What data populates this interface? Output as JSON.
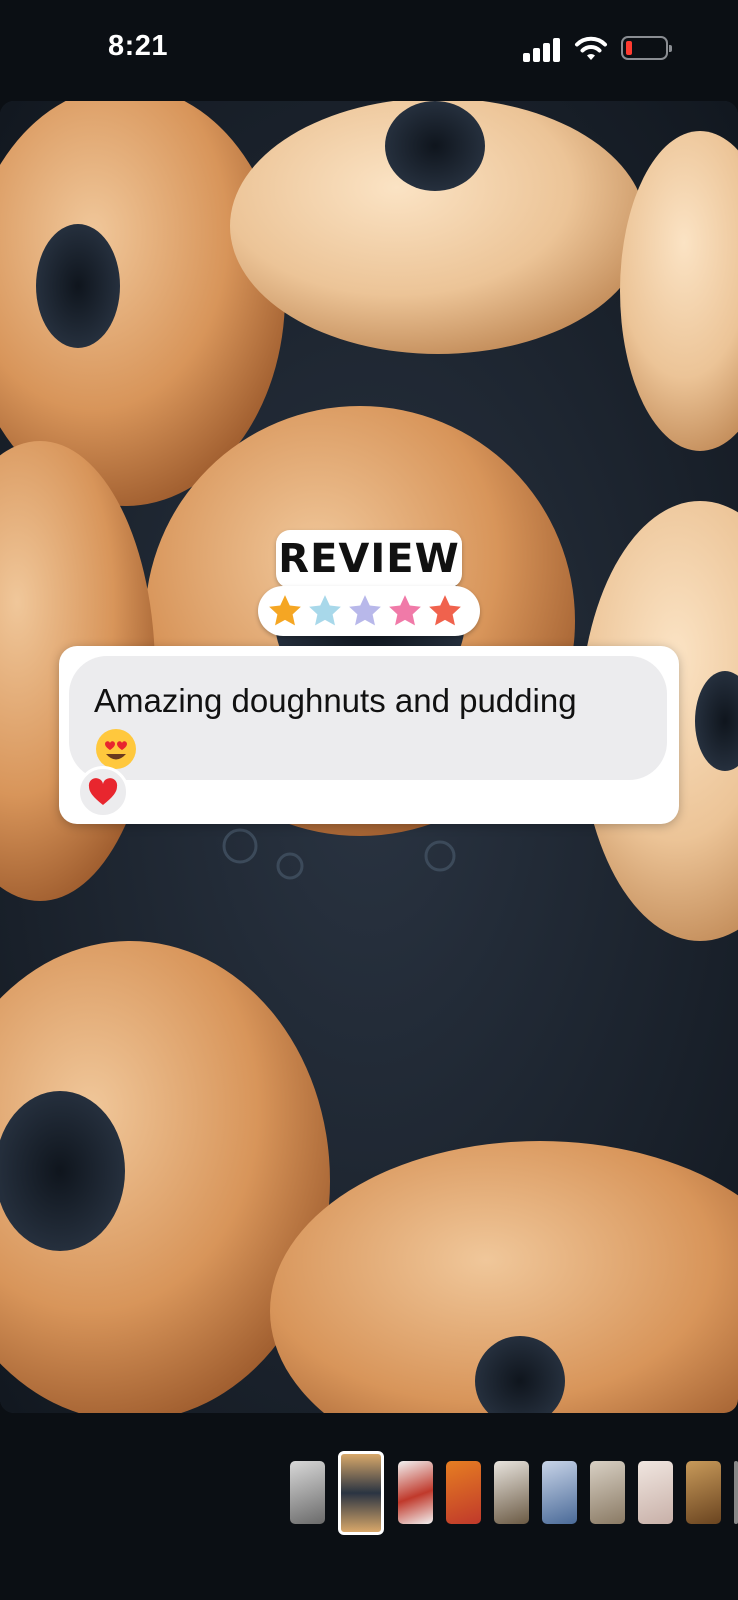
{
  "status_bar": {
    "time": "8:21",
    "signal_icon": "signal-bars-icon",
    "wifi_icon": "wifi-icon",
    "battery_icon": "battery-low-icon",
    "battery_level": 0.12
  },
  "story": {
    "media_description_icon": "doughnuts-frying-photo",
    "review_sticker": {
      "title": "REVIEW",
      "stars": 5,
      "star_colors": [
        "#f5a623",
        "#a8d8ea",
        "#b8b8ea",
        "#f07aa8",
        "#f0624d"
      ]
    },
    "review_card": {
      "text": "Amazing doughnuts and pudding",
      "emoji_icon": "heart-eyes-emoji",
      "reaction_icon": "red-heart-icon"
    }
  },
  "thumbnails": {
    "count": 10,
    "active_index": 1,
    "thumb_colors": [
      "#8a8a8a",
      "#d9a86a",
      "#c0392b",
      "#d35400",
      "#8b7b66",
      "#5a7aa8",
      "#b8a890",
      "#d8c8c0",
      "#a0723a",
      "#888888"
    ]
  }
}
